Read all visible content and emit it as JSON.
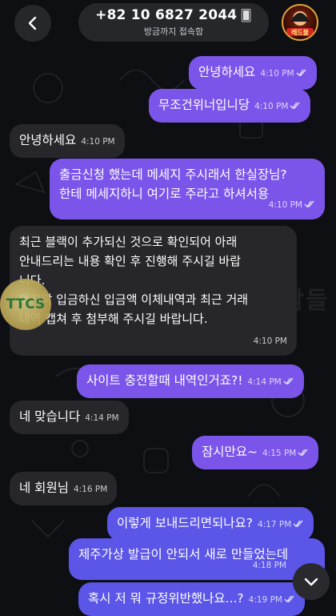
{
  "header": {
    "phone": "+82 10 6827 2044",
    "status": "방금까지 접속함"
  },
  "watermark": "두두를 찾는 사람들",
  "badge_logo": "TTCS",
  "avatar_text": "레드불",
  "colors": {
    "outgoing": "#7b55ea",
    "incoming": "#27272b",
    "background": "#0e0f12"
  },
  "messages": [
    {
      "dir": "out",
      "text": "안녕하세요",
      "time": "4:10 PM"
    },
    {
      "dir": "out",
      "text": "무조건위너입니당",
      "time": "4:10 PM"
    },
    {
      "dir": "in",
      "text": "안녕하세요",
      "time": "4:10 PM"
    },
    {
      "dir": "out",
      "lines": [
        "출금신청 했는데 메세지 주시래서 한실장님?",
        "한테 메세지하니 여기로 주라고 하셔서용"
      ],
      "time": "4:10 PM"
    },
    {
      "dir": "in",
      "lines": [
        "최근 블랙이 추가되신 것으로 확인되어 아래",
        "안내드리는 내용 확인 후 진행해 주시길 바랍",
        "니다.",
        "마지막 입금하신 입금액 이체내역과 최근 거래",
        "내역 캡쳐 후 첨부해 주시길 바랍니다."
      ],
      "time": "4:10 PM"
    },
    {
      "dir": "out",
      "text": "사이트 충전할때 내역인거죠?!",
      "time": "4:14 PM"
    },
    {
      "dir": "in",
      "text": "네 맞습니다",
      "time": "4:14 PM"
    },
    {
      "dir": "out",
      "text": "잠시만요~",
      "time": "4:15 PM"
    },
    {
      "dir": "in",
      "text": "네 회원님",
      "time": "4:16 PM"
    },
    {
      "dir": "out",
      "text": "이렇게 보내드리면되나요?",
      "time": "4:17 PM"
    },
    {
      "dir": "out",
      "lines": [
        "제주가상 발급이 안되서 새로 만들었는데"
      ],
      "time": "4:18 PM"
    },
    {
      "dir": "out",
      "text": "혹시 저 뭐 규정위반했나요...?",
      "time": "4:19 PM"
    }
  ]
}
